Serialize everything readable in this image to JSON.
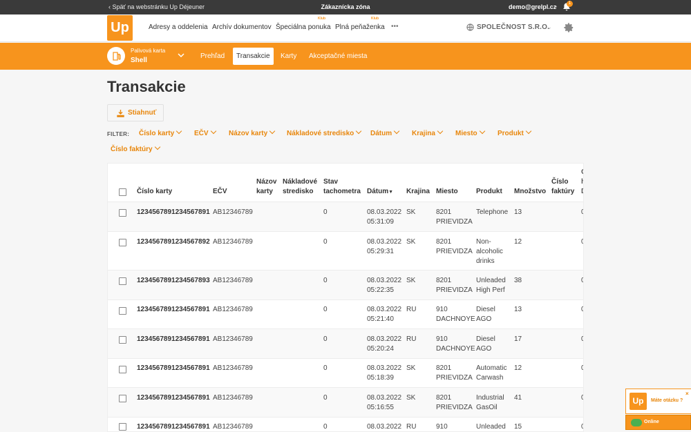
{
  "topbar": {
    "back_link": "‹ Späť na webstránku Up Déjeuner",
    "zone_title": "Zákaznícka zóna",
    "email": "demo@grelpl.cz",
    "notification_count": "1"
  },
  "nav": {
    "logo": "Up",
    "items": [
      "Adresy a oddelenia",
      "Archív dokumentov",
      "Špeciálna ponuka",
      "Plná peňaženka"
    ],
    "klub_badge": "Klub",
    "more": "•••",
    "company": "SPOLEČNOST S.R.O."
  },
  "subnav": {
    "card_label": "Palivová karta",
    "card_value": "Shell",
    "tabs": [
      "Prehľad",
      "Transakcie",
      "Karty",
      "Akceptačné miesta"
    ],
    "active_tab": "Transakcie"
  },
  "page": {
    "title": "Transakcie",
    "download_label": "Stiahnuť",
    "filter_label": "FILTER:",
    "filters": [
      "Číslo karty",
      "EČV",
      "Názov karty",
      "Nákladové stredisko",
      "Dátum",
      "Krajina",
      "Miesto",
      "Produkt",
      "Číslo faktúry"
    ]
  },
  "table": {
    "headers": {
      "card_number": "Číslo karty",
      "ecv": "EČV",
      "card_name_1": "Názov",
      "card_name_2": "karty",
      "cost_center_1": "Nákladové",
      "cost_center_2": "stredisko",
      "odometer_1": "Stav",
      "odometer_2": "tachometra",
      "date": "Dátum",
      "country": "Krajina",
      "place": "Miesto",
      "product": "Produkt",
      "quantity": "Množstvo",
      "invoice_1": "Číslo",
      "invoice_2": "faktúry"
    },
    "rows": [
      {
        "card": "1234567891234567891",
        "ecv": "AB12346789",
        "odo": "0",
        "date": "08.03.2022",
        "time": "05:31:09",
        "country": "SK",
        "place1": "8201",
        "place2": "PRIEVIDZA",
        "prod1": "Telephone",
        "prod2": "",
        "prod3": "",
        "qty": "13"
      },
      {
        "card": "1234567891234567892",
        "ecv": "AB12346789",
        "odo": "0",
        "date": "08.03.2022",
        "time": "05:29:31",
        "country": "SK",
        "place1": "8201",
        "place2": "PRIEVIDZA",
        "prod1": "Non-",
        "prod2": "alcoholic",
        "prod3": "drinks",
        "qty": "12"
      },
      {
        "card": "1234567891234567893",
        "ecv": "AB12346789",
        "odo": "0",
        "date": "08.03.2022",
        "time": "05:22:35",
        "country": "SK",
        "place1": "8201",
        "place2": "PRIEVIDZA",
        "prod1": "Unleaded",
        "prod2": "High Perf",
        "prod3": "",
        "qty": "38"
      },
      {
        "card": "1234567891234567891",
        "ecv": "AB12346789",
        "odo": "0",
        "date": "08.03.2022",
        "time": "05:21:40",
        "country": "RU",
        "place1": "910",
        "place2": "DACHNOYE",
        "prod1": "Diesel",
        "prod2": "AGO",
        "prod3": "",
        "qty": "13"
      },
      {
        "card": "1234567891234567891",
        "ecv": "AB12346789",
        "odo": "0",
        "date": "08.03.2022",
        "time": "05:20:24",
        "country": "RU",
        "place1": "910",
        "place2": "DACHNOYE",
        "prod1": "Diesel",
        "prod2": "AGO",
        "prod3": "",
        "qty": "17"
      },
      {
        "card": "1234567891234567891",
        "ecv": "AB12346789",
        "odo": "0",
        "date": "08.03.2022",
        "time": "05:18:39",
        "country": "SK",
        "place1": "8201",
        "place2": "PRIEVIDZA",
        "prod1": "Automatic",
        "prod2": "Carwash",
        "prod3": "",
        "qty": "12"
      },
      {
        "card": "1234567891234567891",
        "ecv": "AB12346789",
        "odo": "0",
        "date": "08.03.2022",
        "time": "05:16:55",
        "country": "SK",
        "place1": "8201",
        "place2": "PRIEVIDZA",
        "prod1": "Industrial",
        "prod2": "GasOil",
        "prod3": "",
        "qty": "41"
      },
      {
        "card": "1234567891234567891",
        "ecv": "AB12346789",
        "odo": "0",
        "date": "08.03.2022",
        "time": "",
        "country": "RU",
        "place1": "910",
        "place2": "",
        "prod1": "Unleaded",
        "prod2": "",
        "prod3": "",
        "qty": "15"
      }
    ]
  },
  "chat": {
    "logo": "Up",
    "question": "Máte otázku ?",
    "close": "×",
    "status": "Online"
  }
}
